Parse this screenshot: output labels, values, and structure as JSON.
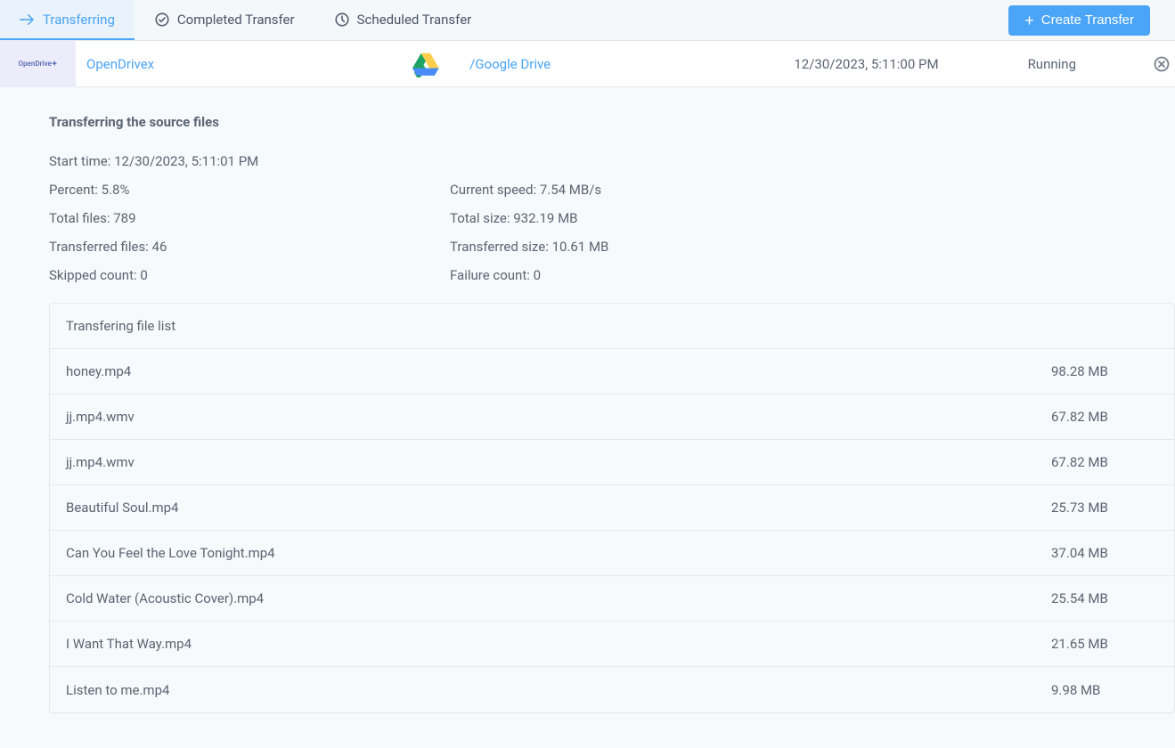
{
  "tabs": {
    "transferring": "Transferring",
    "completed": "Completed Transfer",
    "scheduled": "Scheduled Transfer"
  },
  "createButton": "Create Transfer",
  "transfer": {
    "source": "OpenDrivex",
    "dest": "/Google Drive",
    "timestamp": "12/30/2023, 5:11:00 PM",
    "status": "Running"
  },
  "section": {
    "title": "Transferring the source files"
  },
  "stats": {
    "start_label": "Start time: ",
    "start_value": "12/30/2023, 5:11:01 PM",
    "percent_label": "Percent: ",
    "percent_value": "5.8%",
    "speed_label": "Current speed: ",
    "speed_value": "7.54 MB/s",
    "totalfiles_label": "Total files: ",
    "totalfiles_value": "789",
    "totalsize_label": "Total size: ",
    "totalsize_value": "932.19 MB",
    "transfiles_label": "Transferred files: ",
    "transfiles_value": "46",
    "transsize_label": "Transferred size: ",
    "transsize_value": "10.61 MB",
    "skipped_label": "Skipped count: ",
    "skipped_value": "0",
    "failure_label": "Failure count: ",
    "failure_value": "0"
  },
  "filelist": {
    "title": "Transfering file list",
    "items": [
      {
        "name": "honey.mp4",
        "size": "98.28 MB"
      },
      {
        "name": "jj.mp4.wmv",
        "size": "67.82 MB"
      },
      {
        "name": "jj.mp4.wmv",
        "size": "67.82 MB"
      },
      {
        "name": "Beautiful Soul.mp4",
        "size": "25.73 MB"
      },
      {
        "name": "Can You Feel the Love Tonight.mp4",
        "size": "37.04 MB"
      },
      {
        "name": "Cold Water (Acoustic Cover).mp4",
        "size": "25.54 MB"
      },
      {
        "name": "I Want That Way.mp4",
        "size": "21.65 MB"
      },
      {
        "name": "Listen to me.mp4",
        "size": "9.98 MB"
      }
    ]
  }
}
